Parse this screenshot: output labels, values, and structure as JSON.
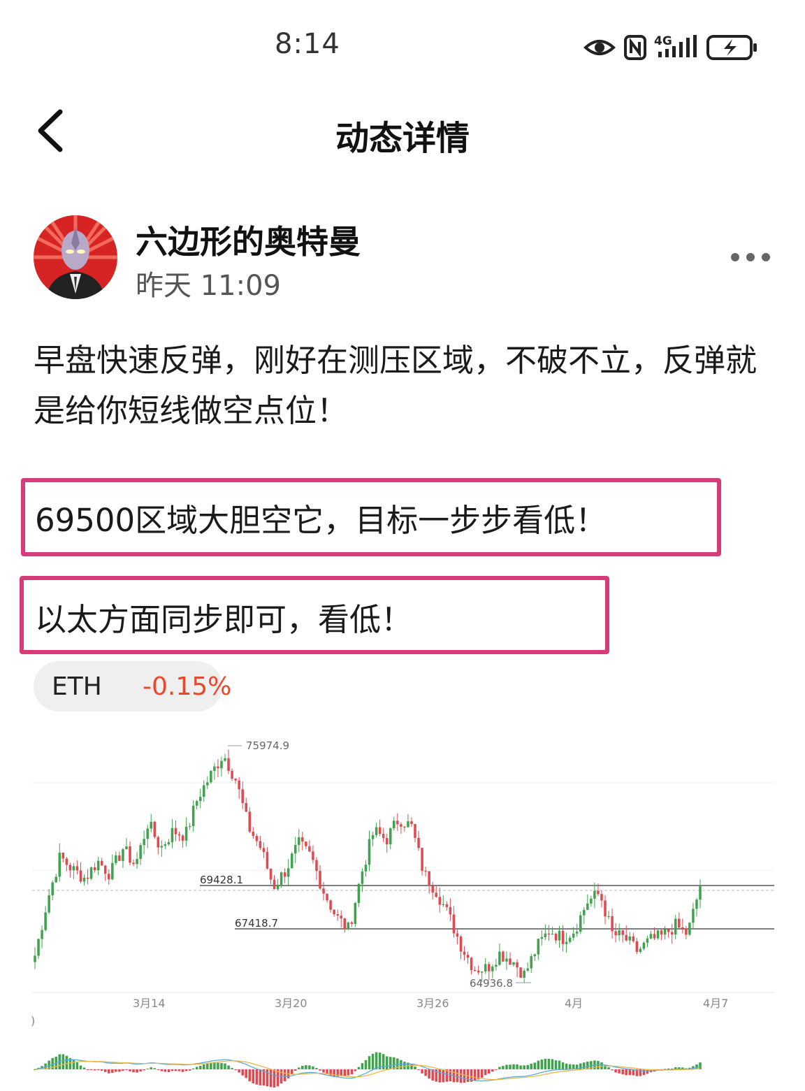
{
  "status_bar": {
    "time": "8:14",
    "network": "4G",
    "icons": [
      "eye-icon",
      "nfc-icon",
      "signal-4g-icon",
      "battery-charging-icon"
    ]
  },
  "nav": {
    "title": "动态详情",
    "back_icon": "chevron-left-icon"
  },
  "author": {
    "name": "六边形的奥特曼",
    "time": "昨天 11:09",
    "more_icon": "more-dots-icon"
  },
  "post": {
    "text": "早盘快速反弹，刚好在测压区域，不破不立，反弹就是给你短线做空点位！",
    "highlight_1": "69500区域大胆空它，目标一步步看低！",
    "highlight_2": "以太方面同步即可，看低！"
  },
  "ticker": {
    "symbol": "ETH",
    "change": "-0.15%",
    "change_color": "#e8492c"
  },
  "chart_data": {
    "type": "candlestick",
    "price_labels": {
      "high": "75974.9",
      "resistance": "69428.1",
      "support": "67418.7",
      "low": "64936.8"
    },
    "levels": {
      "high": 75974.9,
      "resistance": 69428.1,
      "support": 67418.7,
      "low": 64936.8
    },
    "x_tick_labels": [
      "3月14",
      "3月20",
      "3月26",
      "4月",
      "4月7"
    ],
    "up_color": "#3fa34d",
    "down_color": "#e0494f",
    "close_path": [
      66200,
      68800,
      70800,
      70200,
      69800,
      70600,
      70000,
      71200,
      70400,
      72400,
      71200,
      72000,
      71800,
      73600,
      74600,
      75600,
      74400,
      72200,
      71200,
      69400,
      70200,
      71400,
      70800,
      69200,
      68000,
      67400,
      70000,
      72000,
      71600,
      72600,
      72200,
      70000,
      69200,
      68000,
      66600,
      65600,
      65600,
      66300,
      66000,
      65300,
      66600,
      67400,
      67000,
      67400,
      68700,
      69100,
      67200,
      67000,
      66400,
      66900,
      67100,
      67600,
      67200,
      69428
    ]
  }
}
